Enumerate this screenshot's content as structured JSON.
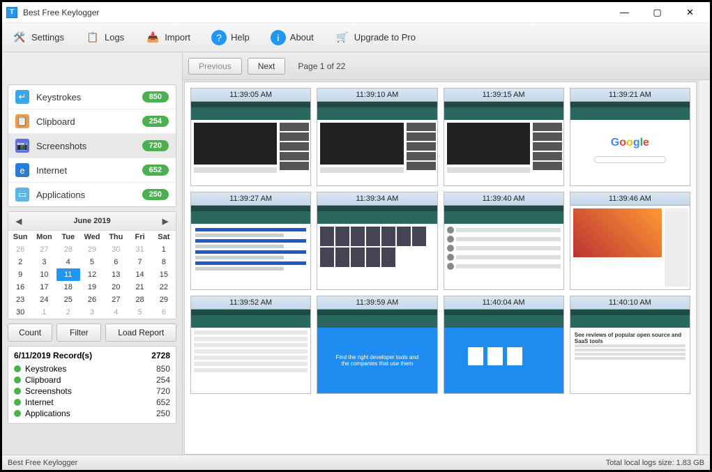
{
  "window": {
    "title": "Best Free Keylogger"
  },
  "menu": {
    "settings": "Settings",
    "logs": "Logs",
    "import": "Import",
    "help": "Help",
    "about": "About",
    "upgrade": "Upgrade to Pro"
  },
  "categories": [
    {
      "id": "keystrokes",
      "label": "Keystrokes",
      "count": "850",
      "selected": false,
      "iconColor": "#3ba7e8"
    },
    {
      "id": "clipboard",
      "label": "Clipboard",
      "count": "254",
      "selected": false,
      "iconColor": "#e89b4f"
    },
    {
      "id": "screenshots",
      "label": "Screenshots",
      "count": "720",
      "selected": true,
      "iconColor": "#5b6fe0"
    },
    {
      "id": "internet",
      "label": "Internet",
      "count": "652",
      "selected": false,
      "iconColor": "#2b7cd3"
    },
    {
      "id": "applications",
      "label": "Applications",
      "count": "250",
      "selected": false,
      "iconColor": "#5fb3e8"
    }
  ],
  "calendar": {
    "month": "June 2019",
    "dow": [
      "Sun",
      "Mon",
      "Tue",
      "Wed",
      "Thu",
      "Fri",
      "Sat"
    ],
    "cells": [
      {
        "d": "26",
        "off": true
      },
      {
        "d": "27",
        "off": true
      },
      {
        "d": "28",
        "off": true
      },
      {
        "d": "29",
        "off": true
      },
      {
        "d": "30",
        "off": true
      },
      {
        "d": "31",
        "off": true
      },
      {
        "d": "1"
      },
      {
        "d": "2"
      },
      {
        "d": "3"
      },
      {
        "d": "4"
      },
      {
        "d": "5"
      },
      {
        "d": "6"
      },
      {
        "d": "7"
      },
      {
        "d": "8"
      },
      {
        "d": "9"
      },
      {
        "d": "10"
      },
      {
        "d": "11",
        "sel": true
      },
      {
        "d": "12"
      },
      {
        "d": "13"
      },
      {
        "d": "14"
      },
      {
        "d": "15"
      },
      {
        "d": "16"
      },
      {
        "d": "17"
      },
      {
        "d": "18"
      },
      {
        "d": "19"
      },
      {
        "d": "20"
      },
      {
        "d": "21"
      },
      {
        "d": "22"
      },
      {
        "d": "23"
      },
      {
        "d": "24"
      },
      {
        "d": "25"
      },
      {
        "d": "26"
      },
      {
        "d": "27"
      },
      {
        "d": "28"
      },
      {
        "d": "29"
      },
      {
        "d": "30"
      },
      {
        "d": "1",
        "off": true
      },
      {
        "d": "2",
        "off": true
      },
      {
        "d": "3",
        "off": true
      },
      {
        "d": "4",
        "off": true
      },
      {
        "d": "5",
        "off": true
      },
      {
        "d": "6",
        "off": true
      }
    ]
  },
  "buttons": {
    "count": "Count",
    "filter": "Filter",
    "load": "Load Report"
  },
  "records": {
    "title": "6/11/2019 Record(s)",
    "total": "2728",
    "rows": [
      {
        "label": "Keystrokes",
        "value": "850"
      },
      {
        "label": "Clipboard",
        "value": "254"
      },
      {
        "label": "Screenshots",
        "value": "720"
      },
      {
        "label": "Internet",
        "value": "652"
      },
      {
        "label": "Applications",
        "value": "250"
      }
    ]
  },
  "paging": {
    "previous": "Previous",
    "next": "Next",
    "info": "Page 1 of 22"
  },
  "thumbs": [
    {
      "time": "11:39:05 AM",
      "kind": "yt"
    },
    {
      "time": "11:39:10 AM",
      "kind": "yt"
    },
    {
      "time": "11:39:15 AM",
      "kind": "yt"
    },
    {
      "time": "11:39:21 AM",
      "kind": "google"
    },
    {
      "time": "11:39:27 AM",
      "kind": "search"
    },
    {
      "time": "11:39:34 AM",
      "kind": "posters"
    },
    {
      "time": "11:39:40 AM",
      "kind": "cast"
    },
    {
      "time": "11:39:46 AM",
      "kind": "hero"
    },
    {
      "time": "11:39:52 AM",
      "kind": "form"
    },
    {
      "time": "11:39:59 AM",
      "kind": "blue",
      "text": "Find the right developer tools and the companies that use them"
    },
    {
      "time": "11:40:04 AM",
      "kind": "bluecards"
    },
    {
      "time": "11:40:10 AM",
      "kind": "review",
      "text": "See reviews of popular open source and SaaS tools"
    }
  ],
  "footer": {
    "left": "Best Free Keylogger",
    "right": "Total local logs size: 1.83 GB"
  }
}
